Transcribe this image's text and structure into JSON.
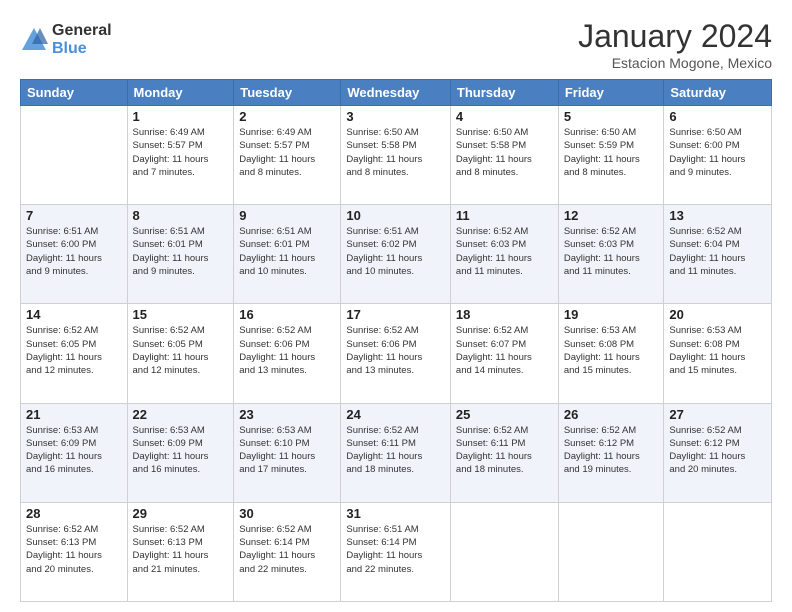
{
  "logo": {
    "general": "General",
    "blue": "Blue"
  },
  "header": {
    "title": "January 2024",
    "subtitle": "Estacion Mogone, Mexico"
  },
  "calendar": {
    "days_of_week": [
      "Sunday",
      "Monday",
      "Tuesday",
      "Wednesday",
      "Thursday",
      "Friday",
      "Saturday"
    ],
    "weeks": [
      [
        {
          "day": "",
          "info": ""
        },
        {
          "day": "1",
          "info": "Sunrise: 6:49 AM\nSunset: 5:57 PM\nDaylight: 11 hours\nand 7 minutes."
        },
        {
          "day": "2",
          "info": "Sunrise: 6:49 AM\nSunset: 5:57 PM\nDaylight: 11 hours\nand 8 minutes."
        },
        {
          "day": "3",
          "info": "Sunrise: 6:50 AM\nSunset: 5:58 PM\nDaylight: 11 hours\nand 8 minutes."
        },
        {
          "day": "4",
          "info": "Sunrise: 6:50 AM\nSunset: 5:58 PM\nDaylight: 11 hours\nand 8 minutes."
        },
        {
          "day": "5",
          "info": "Sunrise: 6:50 AM\nSunset: 5:59 PM\nDaylight: 11 hours\nand 8 minutes."
        },
        {
          "day": "6",
          "info": "Sunrise: 6:50 AM\nSunset: 6:00 PM\nDaylight: 11 hours\nand 9 minutes."
        }
      ],
      [
        {
          "day": "7",
          "info": "Sunrise: 6:51 AM\nSunset: 6:00 PM\nDaylight: 11 hours\nand 9 minutes."
        },
        {
          "day": "8",
          "info": "Sunrise: 6:51 AM\nSunset: 6:01 PM\nDaylight: 11 hours\nand 9 minutes."
        },
        {
          "day": "9",
          "info": "Sunrise: 6:51 AM\nSunset: 6:01 PM\nDaylight: 11 hours\nand 10 minutes."
        },
        {
          "day": "10",
          "info": "Sunrise: 6:51 AM\nSunset: 6:02 PM\nDaylight: 11 hours\nand 10 minutes."
        },
        {
          "day": "11",
          "info": "Sunrise: 6:52 AM\nSunset: 6:03 PM\nDaylight: 11 hours\nand 11 minutes."
        },
        {
          "day": "12",
          "info": "Sunrise: 6:52 AM\nSunset: 6:03 PM\nDaylight: 11 hours\nand 11 minutes."
        },
        {
          "day": "13",
          "info": "Sunrise: 6:52 AM\nSunset: 6:04 PM\nDaylight: 11 hours\nand 11 minutes."
        }
      ],
      [
        {
          "day": "14",
          "info": "Sunrise: 6:52 AM\nSunset: 6:05 PM\nDaylight: 11 hours\nand 12 minutes."
        },
        {
          "day": "15",
          "info": "Sunrise: 6:52 AM\nSunset: 6:05 PM\nDaylight: 11 hours\nand 12 minutes."
        },
        {
          "day": "16",
          "info": "Sunrise: 6:52 AM\nSunset: 6:06 PM\nDaylight: 11 hours\nand 13 minutes."
        },
        {
          "day": "17",
          "info": "Sunrise: 6:52 AM\nSunset: 6:06 PM\nDaylight: 11 hours\nand 13 minutes."
        },
        {
          "day": "18",
          "info": "Sunrise: 6:52 AM\nSunset: 6:07 PM\nDaylight: 11 hours\nand 14 minutes."
        },
        {
          "day": "19",
          "info": "Sunrise: 6:53 AM\nSunset: 6:08 PM\nDaylight: 11 hours\nand 15 minutes."
        },
        {
          "day": "20",
          "info": "Sunrise: 6:53 AM\nSunset: 6:08 PM\nDaylight: 11 hours\nand 15 minutes."
        }
      ],
      [
        {
          "day": "21",
          "info": "Sunrise: 6:53 AM\nSunset: 6:09 PM\nDaylight: 11 hours\nand 16 minutes."
        },
        {
          "day": "22",
          "info": "Sunrise: 6:53 AM\nSunset: 6:09 PM\nDaylight: 11 hours\nand 16 minutes."
        },
        {
          "day": "23",
          "info": "Sunrise: 6:53 AM\nSunset: 6:10 PM\nDaylight: 11 hours\nand 17 minutes."
        },
        {
          "day": "24",
          "info": "Sunrise: 6:52 AM\nSunset: 6:11 PM\nDaylight: 11 hours\nand 18 minutes."
        },
        {
          "day": "25",
          "info": "Sunrise: 6:52 AM\nSunset: 6:11 PM\nDaylight: 11 hours\nand 18 minutes."
        },
        {
          "day": "26",
          "info": "Sunrise: 6:52 AM\nSunset: 6:12 PM\nDaylight: 11 hours\nand 19 minutes."
        },
        {
          "day": "27",
          "info": "Sunrise: 6:52 AM\nSunset: 6:12 PM\nDaylight: 11 hours\nand 20 minutes."
        }
      ],
      [
        {
          "day": "28",
          "info": "Sunrise: 6:52 AM\nSunset: 6:13 PM\nDaylight: 11 hours\nand 20 minutes."
        },
        {
          "day": "29",
          "info": "Sunrise: 6:52 AM\nSunset: 6:13 PM\nDaylight: 11 hours\nand 21 minutes."
        },
        {
          "day": "30",
          "info": "Sunrise: 6:52 AM\nSunset: 6:14 PM\nDaylight: 11 hours\nand 22 minutes."
        },
        {
          "day": "31",
          "info": "Sunrise: 6:51 AM\nSunset: 6:14 PM\nDaylight: 11 hours\nand 22 minutes."
        },
        {
          "day": "",
          "info": ""
        },
        {
          "day": "",
          "info": ""
        },
        {
          "day": "",
          "info": ""
        }
      ]
    ]
  }
}
